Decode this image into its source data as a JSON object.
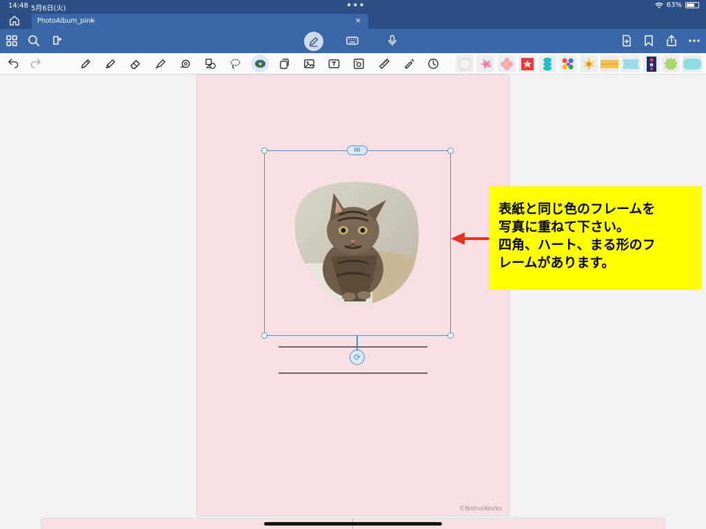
{
  "status_bar": {
    "time": "14:48",
    "date": "5月6日(火)",
    "battery": "63%"
  },
  "tab": {
    "title": "PhotoAlbum_pink"
  },
  "toolbar": {
    "left_icons": [
      "grid-icon",
      "search-icon",
      "lasso-sparkle-icon"
    ],
    "center_icons": [
      "pen-mode-icon",
      "keyboard-icon",
      "microphone-icon"
    ],
    "right_icons": [
      "add-page-icon",
      "bookmark-icon",
      "share-icon",
      "more-icon"
    ]
  },
  "tools": [
    "pen",
    "pencil",
    "eraser",
    "highlighter",
    "shape",
    "elements",
    "lasso",
    "sticker",
    "copy",
    "image",
    "text",
    "camera",
    "ruler",
    "laser-pointer",
    "timer"
  ],
  "stickers": [
    "blank",
    "pink-splash",
    "flower",
    "red-frame",
    "cyan-blob",
    "colorful-flowers",
    "sunburst",
    "tape",
    "cyan-ribbon",
    "patterned-strip",
    "green-badge",
    "cyan-rounded"
  ],
  "selection": {
    "top_handle_label": "III"
  },
  "callout": {
    "lines": [
      "表紙と同じ色のフレームを",
      "写真に重ねて下さい。",
      "四角、ハート、まる形のフ",
      "レームがあります。"
    ]
  },
  "page": {
    "copyright": "©NotiveWorks"
  },
  "colors": {
    "accent": "#3a67a8",
    "page_bg": "#f8dfe2",
    "callout_bg": "#ffff00",
    "arrow": "#e53220",
    "selection": "#4a8fd6"
  }
}
